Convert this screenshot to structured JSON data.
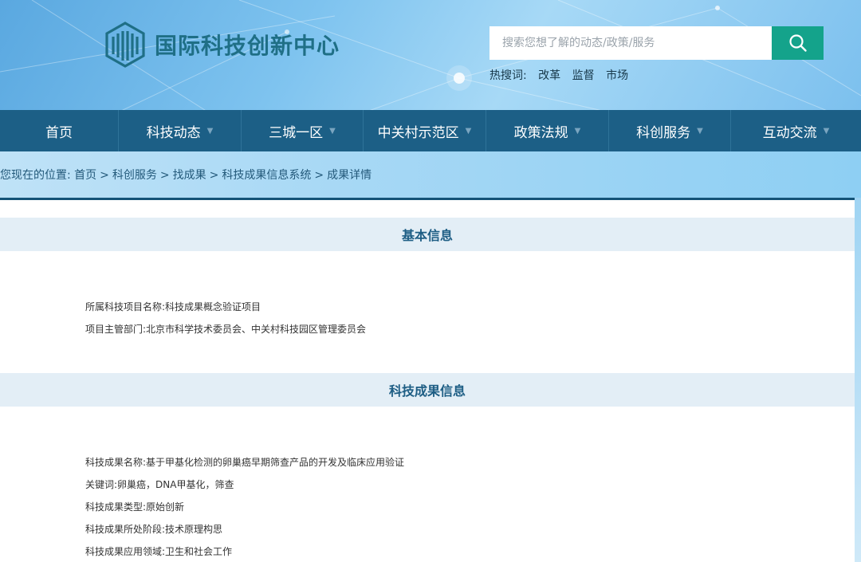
{
  "header": {
    "site_title": "国际科技创新中心",
    "search_placeholder": "搜索您想了解的动态/政策/服务",
    "hot_label": "热搜词:",
    "hot_keywords": [
      "改革",
      "监督",
      "市场"
    ]
  },
  "nav": {
    "items": [
      {
        "label": "首页",
        "dropdown": false
      },
      {
        "label": "科技动态",
        "dropdown": true
      },
      {
        "label": "三城一区",
        "dropdown": true
      },
      {
        "label": "中关村示范区",
        "dropdown": true
      },
      {
        "label": "政策法规",
        "dropdown": true
      },
      {
        "label": "科创服务",
        "dropdown": true
      },
      {
        "label": "互动交流",
        "dropdown": true
      }
    ]
  },
  "breadcrumb": {
    "prefix": "您现在的位置:",
    "items": [
      "首页",
      "科创服务",
      "找成果",
      "科技成果信息系统",
      "成果详情"
    ],
    "separator": ">"
  },
  "sections": [
    {
      "title": "基本信息",
      "fields": [
        {
          "label": "所属科技项目名称:",
          "value": "科技成果概念验证项目"
        },
        {
          "label": "项目主管部门:",
          "value": "北京市科学技术委员会、中关村科技园区管理委员会"
        }
      ]
    },
    {
      "title": "科技成果信息",
      "fields": [
        {
          "label": "科技成果名称:",
          "value": "基于甲基化检测的卵巢癌早期筛查产品的开发及临床应用验证"
        },
        {
          "label": "关键词:",
          "value": "卵巢癌，DNA甲基化，筛查"
        },
        {
          "label": "科技成果类型:",
          "value": "原始创新"
        },
        {
          "label": "科技成果所处阶段:",
          "value": "技术原理构思"
        },
        {
          "label": "科技成果应用领域:",
          "value": "卫生和社会工作"
        }
      ]
    }
  ],
  "colors": {
    "nav_bg": "#1c5f86",
    "search_button": "#14a38b",
    "section_title": "#1d5d84",
    "logo": "#1f6f86"
  },
  "icons": {
    "search": "search-icon",
    "logo": "logo-emblem-icon",
    "caret": "caret-down-icon"
  }
}
